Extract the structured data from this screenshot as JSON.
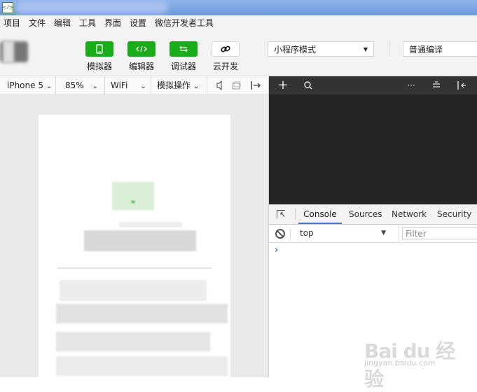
{
  "window": {
    "icon_glyph": "</>"
  },
  "menu": [
    {
      "label": "项目"
    },
    {
      "label": "文件"
    },
    {
      "label": "编辑"
    },
    {
      "label": "工具"
    },
    {
      "label": "界面"
    },
    {
      "label": "设置"
    },
    {
      "label": "微信开发者工具"
    }
  ],
  "toolbar": {
    "buttons": [
      {
        "label": "模拟器",
        "icon": "phone-icon"
      },
      {
        "label": "编辑器",
        "icon": "code-icon"
      },
      {
        "label": "调试器",
        "icon": "debug-icon"
      },
      {
        "label": "云开发",
        "icon": "cloud-link-icon"
      }
    ],
    "mode_select": "小程序模式",
    "compile_select": "普通编译"
  },
  "simulator_bar": {
    "device": "iPhone 5",
    "zoom": "85%",
    "network": "WiFi",
    "sim_actions": "模拟操作"
  },
  "devtools": {
    "tabs": [
      "Console",
      "Sources",
      "Network",
      "Security"
    ],
    "active_tab": "Console",
    "context": "top",
    "filter_placeholder": "Filter",
    "prompt": "›"
  },
  "watermark": {
    "brand": "Bai du 经验",
    "url": "jingyan.baidu.com"
  },
  "colors": {
    "green_button": "#1aad19",
    "devtools_dark": "#242424",
    "accent_blue": "#3879d9"
  }
}
